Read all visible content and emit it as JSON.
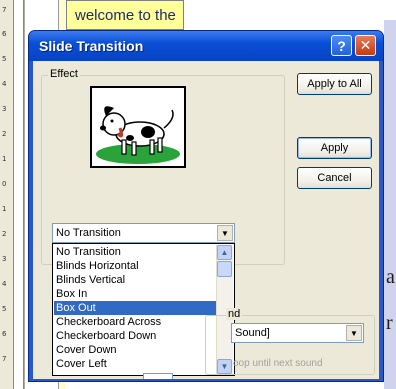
{
  "background": {
    "ruler_numbers": [
      "7",
      "6",
      "5",
      "4",
      "3",
      "2",
      "1",
      "0",
      "1",
      "2",
      "3",
      "4",
      "5",
      "6",
      "7"
    ],
    "welcome_text": "welcome to the",
    "side_letters": [
      "a",
      "r"
    ]
  },
  "dialog": {
    "title": "Slide Transition",
    "help_label": "?",
    "close_label": "✕",
    "effect": {
      "group_label": "Effect",
      "picture_alt": "dog-picture",
      "selected_value": "No Transition",
      "options": [
        "No Transition",
        "Blinds Horizontal",
        "Blinds Vertical",
        "Box In",
        "Box Out",
        "Checkerboard Across",
        "Checkerboard Down",
        "Cover Down",
        "Cover Left"
      ],
      "highlighted_option": "Box Out"
    },
    "buttons": {
      "apply_all": "Apply to All",
      "apply": "Apply",
      "cancel": "Cancel"
    },
    "sound": {
      "group_label_partial": "nd",
      "value_partial": "Sound]",
      "loop_text_partial": "oop until next sound"
    }
  },
  "colors": {
    "titlebar": "#0a4fd6",
    "selection": "#316ac5",
    "dialog_bg": "#ece9d8"
  }
}
